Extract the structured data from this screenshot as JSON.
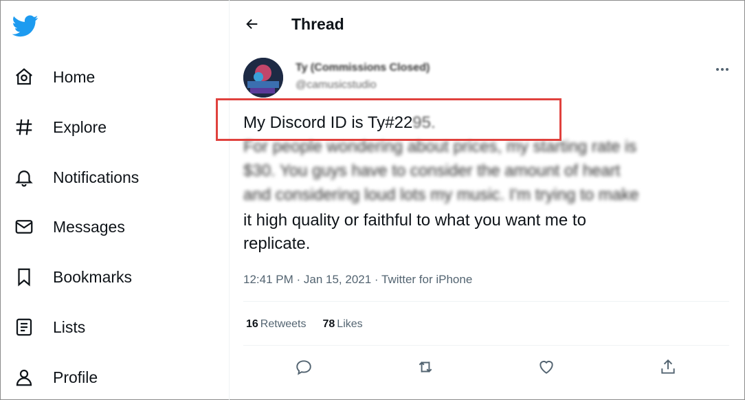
{
  "sidebar": {
    "logo": "twitter-bird-icon",
    "items": [
      {
        "label": "Home",
        "icon": "home-icon"
      },
      {
        "label": "Explore",
        "icon": "hashtag-icon"
      },
      {
        "label": "Notifications",
        "icon": "bell-icon"
      },
      {
        "label": "Messages",
        "icon": "envelope-icon"
      },
      {
        "label": "Bookmarks",
        "icon": "bookmark-icon"
      },
      {
        "label": "Lists",
        "icon": "list-icon"
      },
      {
        "label": "Profile",
        "icon": "person-icon"
      }
    ]
  },
  "header": {
    "title": "Thread",
    "back_icon": "arrow-left-icon"
  },
  "tweet": {
    "author_name": "Ty (Commissions Closed)",
    "author_handle": "@camusicstudio",
    "line1_clear": "My Discord ID is Ty#22",
    "line1_blurred": "95.",
    "blurred_lines": [
      "For people wondering about prices, my starting rate is",
      "$30. You guys have to consider the amount of heart",
      "and considering loud lots my music. I'm trying to make"
    ],
    "clear_lines": [
      "it high quality or faithful to what you want me to",
      "replicate."
    ],
    "time": "12:41 PM",
    "date": "Jan 15, 2021",
    "source": "Twitter for iPhone",
    "retweets_count": "16",
    "retweets_label": "Retweets",
    "likes_count": "78",
    "likes_label": "Likes"
  },
  "colors": {
    "brand": "#1d9bf0",
    "highlight": "#e0413d",
    "secondary_text": "#536471"
  },
  "actions": [
    "reply-icon",
    "retweet-icon",
    "like-icon",
    "share-icon"
  ]
}
